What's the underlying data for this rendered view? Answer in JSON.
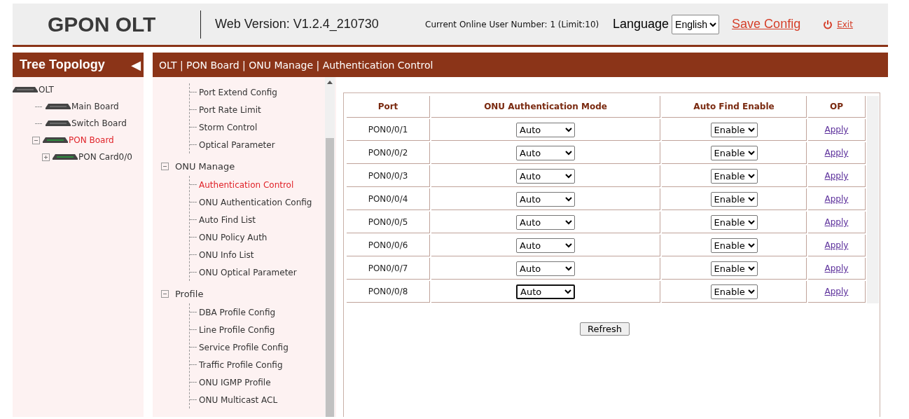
{
  "header": {
    "title": "GPON OLT",
    "version": "Web Version: V1.2.4_210730",
    "online_users": "Current Online User Number: 1 (Limit:10)",
    "language_label": "Language",
    "language": "English",
    "save_link": "Save Config",
    "exit_link": "Exit"
  },
  "tree": {
    "title": "Tree Topology",
    "collapse_icon": "◀",
    "root": {
      "label": "OLT",
      "selected": false,
      "children": [
        {
          "label": "Main Board",
          "selected": false
        },
        {
          "label": "Switch Board",
          "selected": false
        },
        {
          "label": "PON Board",
          "selected": true,
          "expanded": true,
          "children": [
            {
              "label": "PON Card0/0",
              "selected": false,
              "expanded": false
            }
          ]
        }
      ]
    }
  },
  "breadcrumb": "OLT | PON Board | ONU Manage | Authentication Control",
  "nav": {
    "sections": [
      {
        "items": [
          {
            "label": "Port Extend Config",
            "selected": false
          },
          {
            "label": "Port Rate Limit",
            "selected": false
          },
          {
            "label": "Storm Control",
            "selected": false
          },
          {
            "label": "Optical Parameter",
            "selected": false
          }
        ]
      },
      {
        "title": "ONU Manage",
        "expanded": true,
        "items": [
          {
            "label": "Authentication Control",
            "selected": true
          },
          {
            "label": "ONU Authentication Config",
            "selected": false
          },
          {
            "label": "Auto Find List",
            "selected": false
          },
          {
            "label": "ONU Policy Auth",
            "selected": false
          },
          {
            "label": "ONU Info List",
            "selected": false
          },
          {
            "label": "ONU Optical Parameter",
            "selected": false
          }
        ]
      },
      {
        "title": "Profile",
        "expanded": true,
        "items": [
          {
            "label": "DBA Profile Config",
            "selected": false
          },
          {
            "label": "Line Profile Config",
            "selected": false
          },
          {
            "label": "Service Profile Config",
            "selected": false
          },
          {
            "label": "Traffic Profile Config",
            "selected": false
          },
          {
            "label": "ONU IGMP Profile",
            "selected": false
          },
          {
            "label": "ONU Multicast ACL",
            "selected": false
          }
        ]
      }
    ]
  },
  "table": {
    "columns": [
      "Port",
      "ONU Authentication Mode",
      "Auto Find Enable",
      "OP"
    ],
    "rows": [
      {
        "port": "PON0/0/1",
        "mode": "Auto",
        "auto_find": "Enable",
        "action": "Apply",
        "focused": false
      },
      {
        "port": "PON0/0/2",
        "mode": "Auto",
        "auto_find": "Enable",
        "action": "Apply",
        "focused": false
      },
      {
        "port": "PON0/0/3",
        "mode": "Auto",
        "auto_find": "Enable",
        "action": "Apply",
        "focused": false
      },
      {
        "port": "PON0/0/4",
        "mode": "Auto",
        "auto_find": "Enable",
        "action": "Apply",
        "focused": false
      },
      {
        "port": "PON0/0/5",
        "mode": "Auto",
        "auto_find": "Enable",
        "action": "Apply",
        "focused": false
      },
      {
        "port": "PON0/0/6",
        "mode": "Auto",
        "auto_find": "Enable",
        "action": "Apply",
        "focused": false
      },
      {
        "port": "PON0/0/7",
        "mode": "Auto",
        "auto_find": "Enable",
        "action": "Apply",
        "focused": false
      },
      {
        "port": "PON0/0/8",
        "mode": "Auto",
        "auto_find": "Enable",
        "action": "Apply",
        "focused": true
      }
    ]
  },
  "refresh_button": "Refresh"
}
